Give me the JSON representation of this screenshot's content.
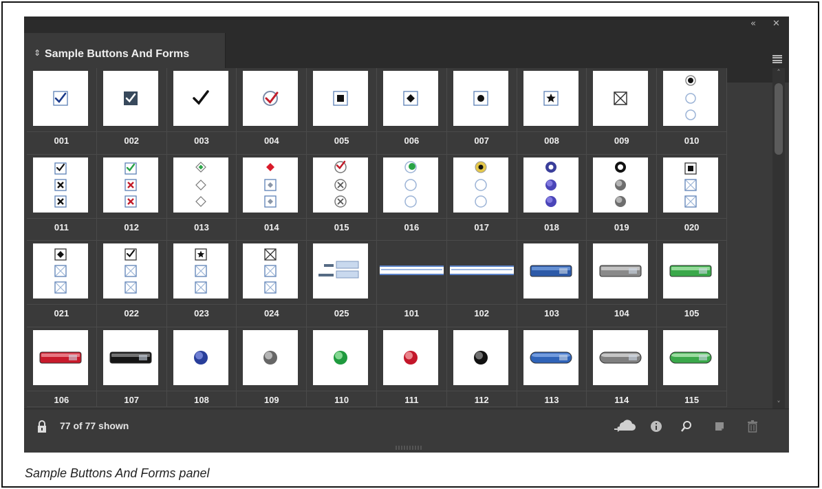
{
  "panel": {
    "title": "Sample Buttons And Forms",
    "status": "77 of 77 shown",
    "caption": "Sample Buttons And Forms panel"
  },
  "icons": {
    "collapse": "double-chevron-left-icon",
    "close": "close-icon",
    "menu": "hamburger-menu-icon",
    "lock": "lock-icon",
    "cloud": "cloud-place-icon",
    "info": "info-icon",
    "search": "search-icon",
    "new": "new-item-icon",
    "trash": "trash-icon"
  },
  "colors": {
    "panel_bg": "#3a3a3a",
    "header_bg": "#2b2b2b",
    "label_text": "#f0f0f0",
    "thumb_bg": "#ffffff"
  },
  "items": [
    {
      "label": "001",
      "type": "check-box"
    },
    {
      "label": "002",
      "type": "check-box-dark"
    },
    {
      "label": "003",
      "type": "checkmark"
    },
    {
      "label": "004",
      "type": "check-circle"
    },
    {
      "label": "005",
      "type": "square-in-box"
    },
    {
      "label": "006",
      "type": "diamond-in-box"
    },
    {
      "label": "007",
      "type": "circle-in-box"
    },
    {
      "label": "008",
      "type": "star-in-box"
    },
    {
      "label": "009",
      "type": "cross-box"
    },
    {
      "label": "010",
      "type": "radio-stack"
    },
    {
      "label": "011",
      "type": "check-x-stack"
    },
    {
      "label": "012",
      "type": "check-x-color-stack"
    },
    {
      "label": "013",
      "type": "diamond-green-stack"
    },
    {
      "label": "014",
      "type": "diamond-red-stack"
    },
    {
      "label": "015",
      "type": "circle-check-stack"
    },
    {
      "label": "016",
      "type": "radio-green-stack"
    },
    {
      "label": "017",
      "type": "radio-yellow-stack"
    },
    {
      "label": "018",
      "type": "radio-blue-stack"
    },
    {
      "label": "019",
      "type": "radio-gray-stack"
    },
    {
      "label": "020",
      "type": "square-cross-stack"
    },
    {
      "label": "021",
      "type": "diamond-cross-stack"
    },
    {
      "label": "022",
      "type": "check-cross-stack"
    },
    {
      "label": "023",
      "type": "star-cross-stack"
    },
    {
      "label": "024",
      "type": "cross-cross-stack"
    },
    {
      "label": "025",
      "type": "text-fields"
    },
    {
      "label": "101",
      "type": "field-bar"
    },
    {
      "label": "102",
      "type": "field-bar"
    },
    {
      "label": "103",
      "type": "pill-blue"
    },
    {
      "label": "104",
      "type": "pill-gray"
    },
    {
      "label": "105",
      "type": "pill-green"
    },
    {
      "label": "106",
      "type": "pill-red"
    },
    {
      "label": "107",
      "type": "pill-black"
    },
    {
      "label": "108",
      "type": "ball-blue"
    },
    {
      "label": "109",
      "type": "ball-gray"
    },
    {
      "label": "110",
      "type": "ball-green"
    },
    {
      "label": "111",
      "type": "ball-red"
    },
    {
      "label": "112",
      "type": "ball-black"
    },
    {
      "label": "113",
      "type": "round-blue"
    },
    {
      "label": "114",
      "type": "round-gray"
    },
    {
      "label": "115",
      "type": "round-green"
    }
  ]
}
